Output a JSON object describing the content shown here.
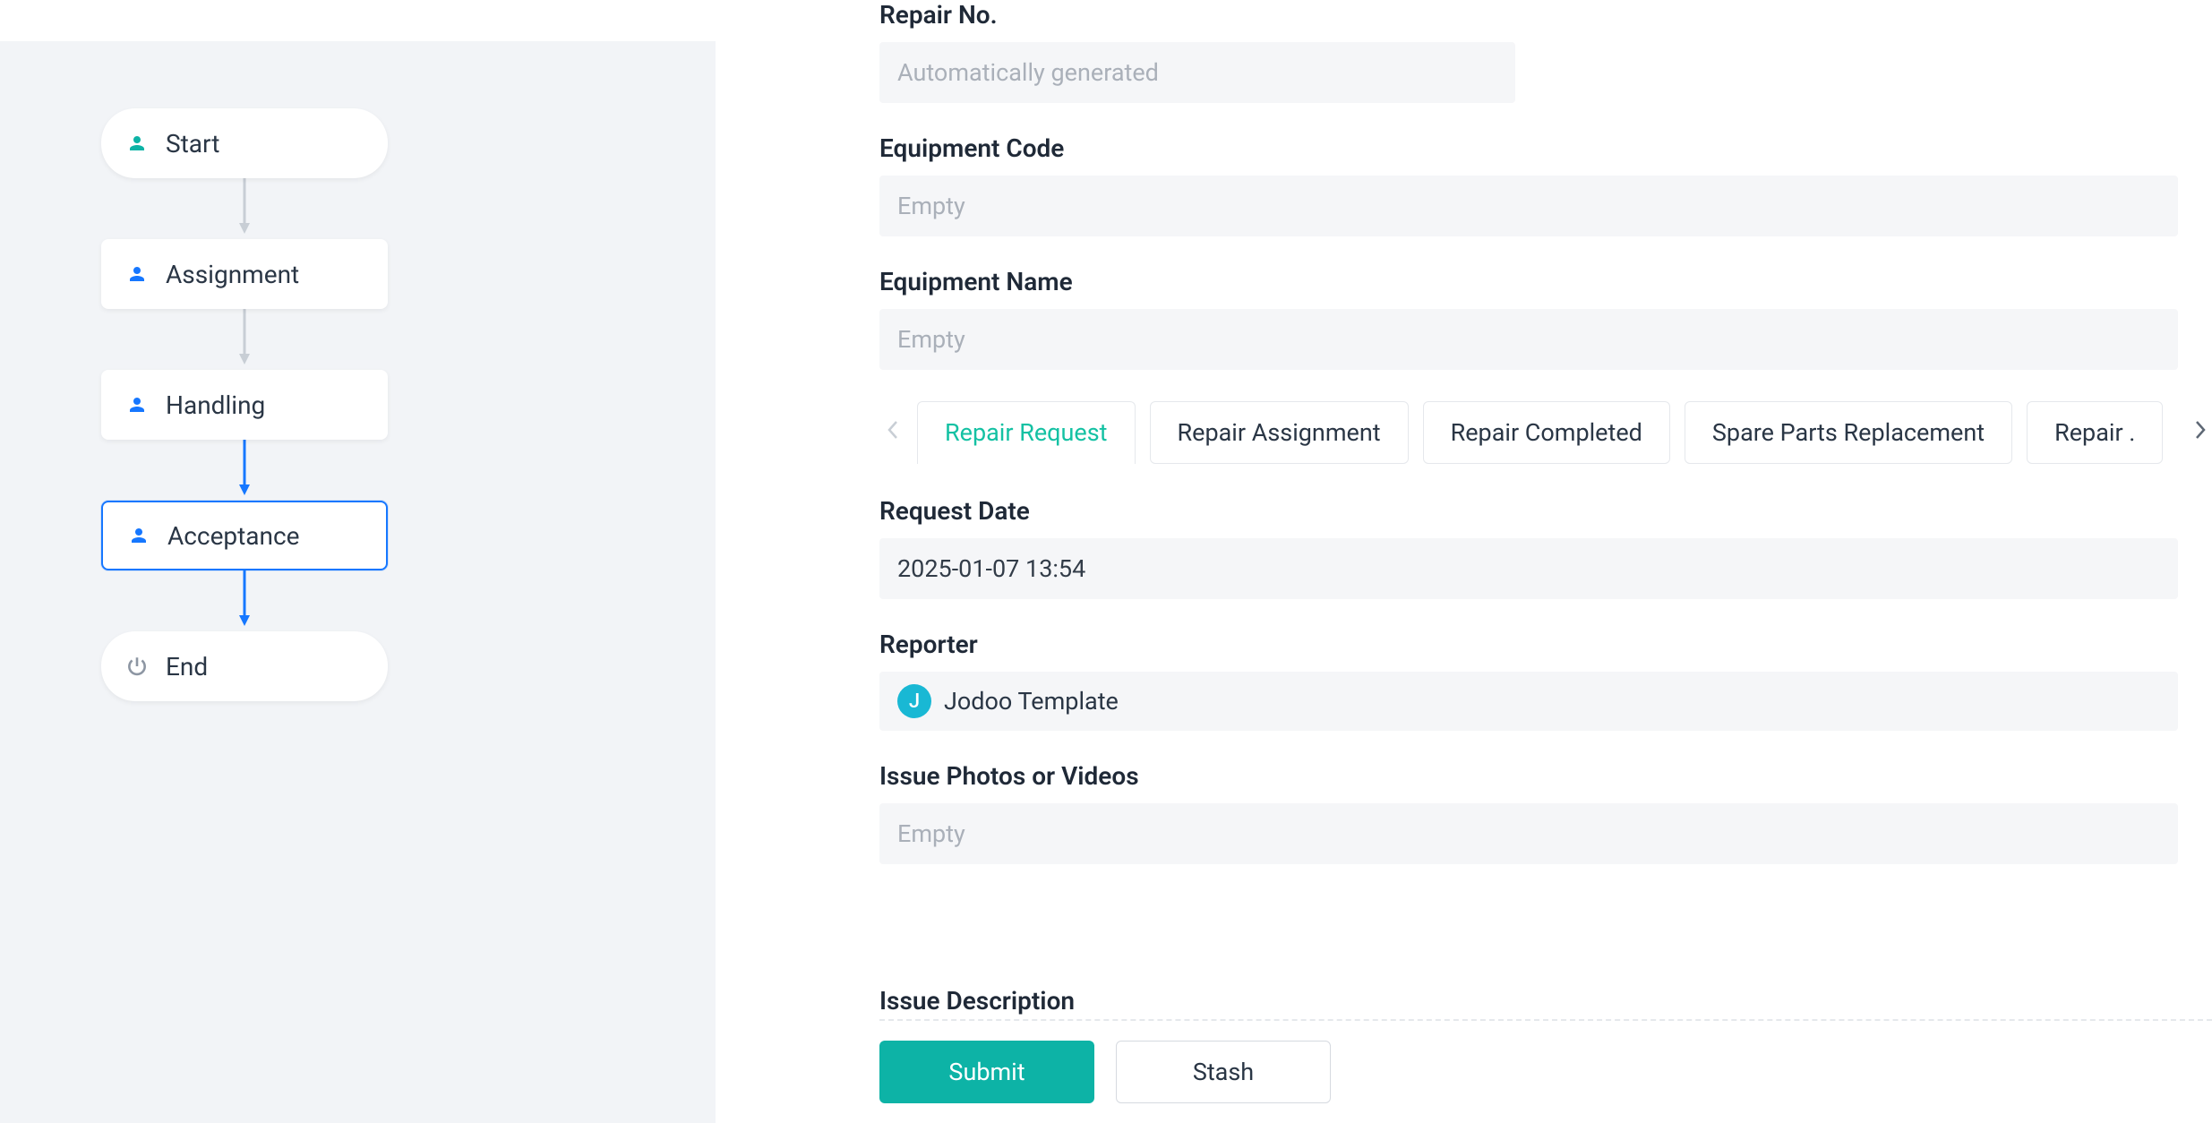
{
  "workflow": {
    "nodes": [
      {
        "id": "start",
        "label": "Start",
        "icon": "person-green",
        "shape": "pill"
      },
      {
        "id": "assignment",
        "label": "Assignment",
        "icon": "person-blue",
        "shape": "rect"
      },
      {
        "id": "handling",
        "label": "Handling",
        "icon": "person-blue",
        "shape": "rect"
      },
      {
        "id": "acceptance",
        "label": "Acceptance",
        "icon": "person-blue",
        "shape": "rect",
        "active": true
      },
      {
        "id": "end",
        "label": "End",
        "icon": "power-grey",
        "shape": "pill"
      }
    ],
    "arrows": [
      {
        "after": "start",
        "color": "grey"
      },
      {
        "after": "assignment",
        "color": "grey"
      },
      {
        "after": "handling",
        "color": "blue"
      },
      {
        "after": "acceptance",
        "color": "blue"
      }
    ]
  },
  "form": {
    "repair_no": {
      "label": "Repair No.",
      "placeholder": "Automatically generated"
    },
    "equipment_code": {
      "label": "Equipment Code",
      "placeholder": "Empty"
    },
    "equipment_name": {
      "label": "Equipment Name",
      "placeholder": "Empty"
    },
    "request_date": {
      "label": "Request Date",
      "value": "2025-01-07 13:54"
    },
    "reporter": {
      "label": "Reporter",
      "avatar_initial": "J",
      "name": "Jodoo Template"
    },
    "issue_photos": {
      "label": "Issue Photos or Videos",
      "placeholder": "Empty"
    },
    "issue_description": {
      "label": "Issue Description"
    }
  },
  "tabs": {
    "items": [
      {
        "label": "Repair Request",
        "active": true
      },
      {
        "label": "Repair Assignment"
      },
      {
        "label": "Repair Completed"
      },
      {
        "label": "Spare Parts Replacement"
      },
      {
        "label": "Repair ."
      }
    ]
  },
  "buttons": {
    "submit": "Submit",
    "stash": "Stash"
  }
}
